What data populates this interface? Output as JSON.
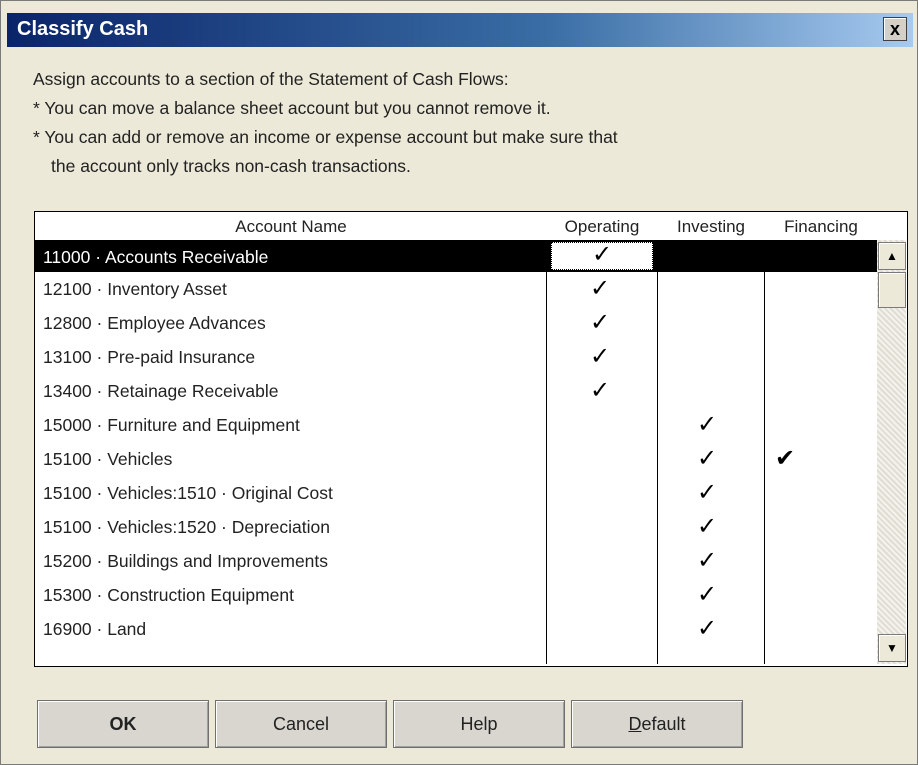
{
  "window": {
    "title": "Classify Cash",
    "close_label": "x"
  },
  "instructions": {
    "line1": "Assign accounts to a section of the Statement of Cash Flows:",
    "line2": "* You can move a balance sheet account but you cannot remove it.",
    "line3": "* You can add or remove an income or expense account but make sure that",
    "line4": "the account only tracks non-cash transactions."
  },
  "grid": {
    "columns": {
      "name": "Account Name",
      "operating": "Operating",
      "investing": "Investing",
      "financing": "Financing"
    },
    "check_glyph": "✓",
    "rows": [
      {
        "name": "11000 · Accounts Receivable",
        "operating": "✓",
        "investing": "",
        "financing": ""
      },
      {
        "name": "12100 · Inventory Asset",
        "operating": "✓",
        "investing": "",
        "financing": ""
      },
      {
        "name": "12800 · Employee Advances",
        "operating": "✓",
        "investing": "",
        "financing": ""
      },
      {
        "name": "13100 · Pre-paid Insurance",
        "operating": "✓",
        "investing": "",
        "financing": ""
      },
      {
        "name": "13400 · Retainage Receivable",
        "operating": "✓",
        "investing": "",
        "financing": ""
      },
      {
        "name": "15000 · Furniture and Equipment",
        "operating": "",
        "investing": "✓",
        "financing": ""
      },
      {
        "name": "15100 · Vehicles",
        "operating": "",
        "investing": "✓",
        "financing": "✔"
      },
      {
        "name": "15100 · Vehicles:1510 · Original Cost",
        "operating": "",
        "investing": "✓",
        "financing": ""
      },
      {
        "name": "15100 · Vehicles:1520 · Depreciation",
        "operating": "",
        "investing": "✓",
        "financing": ""
      },
      {
        "name": "15200 · Buildings and Improvements",
        "operating": "",
        "investing": "✓",
        "financing": ""
      },
      {
        "name": "15300 · Construction Equipment",
        "operating": "",
        "investing": "✓",
        "financing": ""
      },
      {
        "name": "16900 · Land",
        "operating": "",
        "investing": "✓",
        "financing": ""
      }
    ],
    "scroll_up_icon": "▲",
    "scroll_down_icon": "▼"
  },
  "buttons": {
    "ok": "OK",
    "cancel": "Cancel",
    "help": "Help",
    "default_first": "D",
    "default_rest": "efault"
  }
}
